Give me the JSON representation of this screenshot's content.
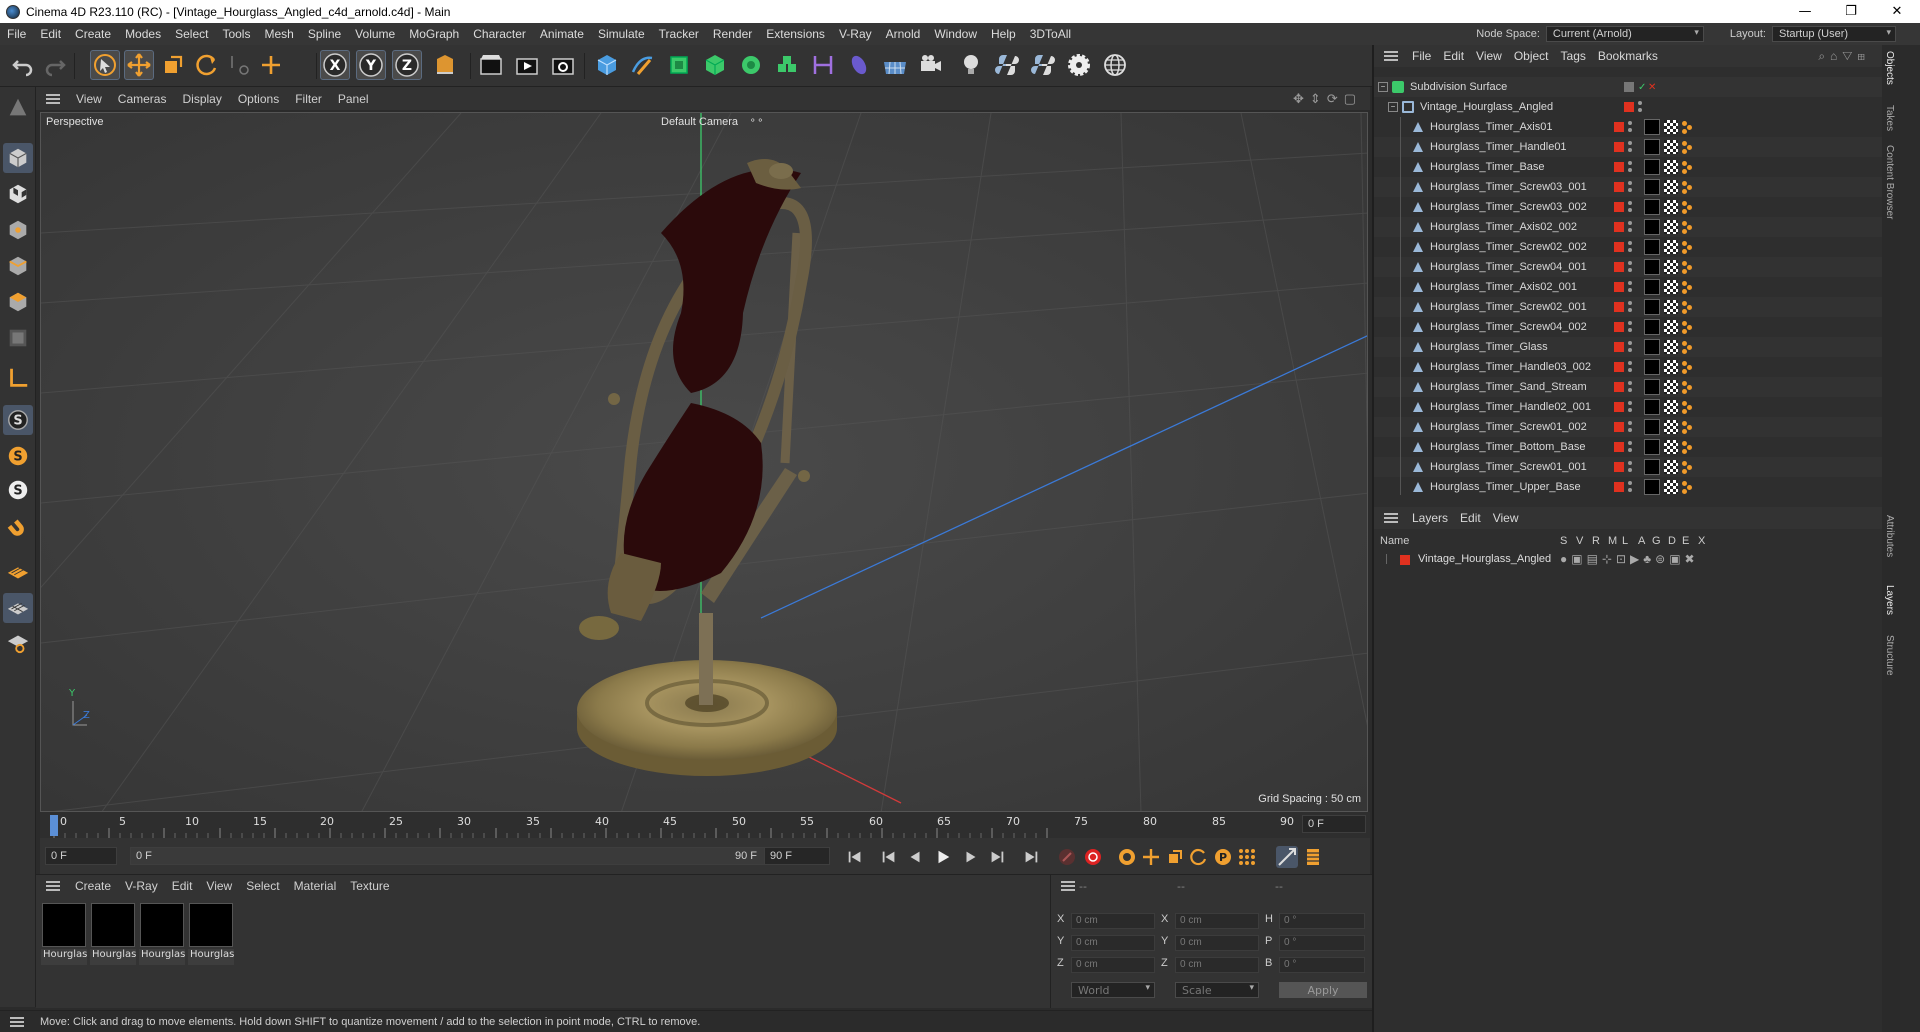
{
  "window": {
    "title": "Cinema 4D R23.110 (RC) - [Vintage_Hourglass_Angled_c4d_arnold.c4d] - Main",
    "minimize": "—",
    "maximize": "❐",
    "close": "✕"
  },
  "menubar": {
    "items": [
      "File",
      "Edit",
      "Create",
      "Modes",
      "Select",
      "Tools",
      "Mesh",
      "Spline",
      "Volume",
      "MoGraph",
      "Character",
      "Animate",
      "Simulate",
      "Tracker",
      "Render",
      "Extensions",
      "V-Ray",
      "Arnold",
      "Window",
      "Help",
      "3DToAll"
    ],
    "node_space_label": "Node Space:",
    "node_space_value": "Current (Arnold)",
    "layout_label": "Layout:",
    "layout_value": "Startup (User)"
  },
  "viewport": {
    "menu": [
      "View",
      "Cameras",
      "Display",
      "Options",
      "Filter",
      "Panel"
    ],
    "view_name": "Perspective",
    "camera_name": "Default Camera",
    "grid_spacing": "Grid Spacing : 50 cm",
    "axis_labels": {
      "y": "Y",
      "z": "Z"
    }
  },
  "timeline": {
    "ticks": [
      "0",
      "5",
      "10",
      "15",
      "20",
      "25",
      "30",
      "35",
      "40",
      "45",
      "50",
      "55",
      "60",
      "65",
      "70",
      "75",
      "80",
      "85",
      "90"
    ],
    "current_frame": "0 F"
  },
  "transport": {
    "start_field": "0 F",
    "range_start": "0 F",
    "range_end": "90 F",
    "end_field": "90 F"
  },
  "materials": {
    "menu": [
      "Create",
      "V-Ray",
      "Edit",
      "View",
      "Select",
      "Material",
      "Texture"
    ],
    "items": [
      "Hourglas",
      "Hourglas",
      "Hourglas",
      "Hourglas"
    ]
  },
  "coords": {
    "headers": [
      "--",
      "--",
      "--"
    ],
    "rows": [
      {
        "a": "X",
        "av": "0 cm",
        "b": "X",
        "bv": "0 cm",
        "c": "H",
        "cv": "0 °"
      },
      {
        "a": "Y",
        "av": "0 cm",
        "b": "Y",
        "bv": "0 cm",
        "c": "P",
        "cv": "0 °"
      },
      {
        "a": "Z",
        "av": "0 cm",
        "b": "Z",
        "bv": "0 cm",
        "c": "B",
        "cv": "0 °"
      }
    ],
    "space": "World",
    "mode": "Scale",
    "apply": "Apply"
  },
  "status": {
    "text": "Move: Click and drag to move elements. Hold down SHIFT to quantize movement / add to the selection in point mode, CTRL to remove."
  },
  "objects": {
    "menu": [
      "File",
      "Edit",
      "View",
      "Object",
      "Tags",
      "Bookmarks"
    ],
    "root": "Subdivision Surface",
    "group": "Vintage_Hourglass_Angled",
    "children": [
      "Hourglass_Timer_Axis01",
      "Hourglass_Timer_Handle01",
      "Hourglass_Timer_Base",
      "Hourglass_Timer_Screw03_001",
      "Hourglass_Timer_Screw03_002",
      "Hourglass_Timer_Axis02_002",
      "Hourglass_Timer_Screw02_002",
      "Hourglass_Timer_Screw04_001",
      "Hourglass_Timer_Axis02_001",
      "Hourglass_Timer_Screw02_001",
      "Hourglass_Timer_Screw04_002",
      "Hourglass_Timer_Glass",
      "Hourglass_Timer_Handle03_002",
      "Hourglass_Timer_Sand_Stream",
      "Hourglass_Timer_Handle02_001",
      "Hourglass_Timer_Screw01_002",
      "Hourglass_Timer_Bottom_Base",
      "Hourglass_Timer_Screw01_001",
      "Hourglass_Timer_Upper_Base"
    ]
  },
  "layers": {
    "menu": [
      "Layers",
      "Edit",
      "View"
    ],
    "name_header": "Name",
    "flag_headers": [
      "S",
      "V",
      "R",
      "M",
      "L",
      "A",
      "G",
      "D",
      "E",
      "X"
    ],
    "items": [
      "Vintage_Hourglass_Angled"
    ]
  },
  "side_tabs": [
    "Objects",
    "Takes",
    "Content Browser",
    "Attributes",
    "Layers",
    "Structure"
  ],
  "colors": {
    "accent": "#5b8fd6",
    "tag_red": "#e0311f",
    "selection": "#4a5668"
  }
}
